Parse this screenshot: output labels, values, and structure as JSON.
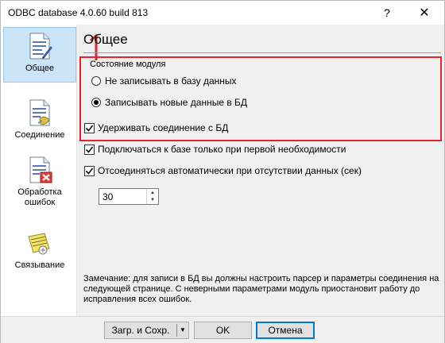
{
  "window": {
    "title": "ODBC database 4.0.60 build 813",
    "help_label": "?",
    "close_label": "✕"
  },
  "sidebar": {
    "items": [
      {
        "label": "Общее",
        "icon": "document-edit-icon",
        "selected": true
      },
      {
        "label": "Соединение",
        "icon": "document-connection-icon",
        "selected": false
      },
      {
        "label": "Обработка ошибок",
        "icon": "document-error-icon",
        "selected": false
      },
      {
        "label": "Связывание",
        "icon": "document-link-icon",
        "selected": false
      }
    ]
  },
  "main": {
    "page_title": "Общее",
    "group_label": "Состояние модуля",
    "radios": [
      {
        "label": "Не записывать в базу данных",
        "checked": false
      },
      {
        "label": "Записывать новые данные в БД",
        "checked": true
      }
    ],
    "checkboxes": [
      {
        "label": "Удерживать соединение с БД",
        "checked": true
      },
      {
        "label": "Подключаться к базе только при первой необходимости",
        "checked": true
      },
      {
        "label": "Отсоединяться автоматически при отсутствии данных (сек)",
        "checked": true
      }
    ],
    "timeout_value": "30",
    "note": "Замечание: для записи в БД вы должны настроить парсер и параметры соединения на следующей странице. С неверными параметрами модуль приостановит работу до исправления всех ошибок.",
    "highlight_color": "#e5242f"
  },
  "buttons": {
    "load_save": "Загр. и Сохр.",
    "ok": "OK",
    "cancel": "Отмена"
  }
}
